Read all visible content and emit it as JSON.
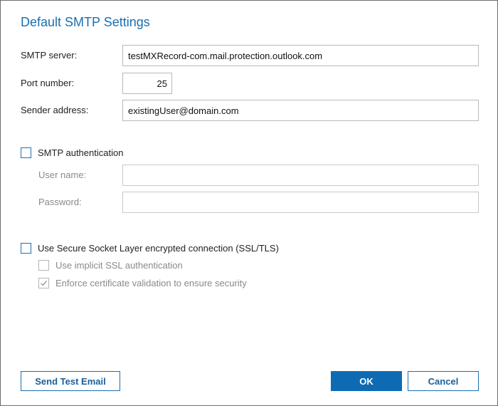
{
  "dialog": {
    "title": "Default SMTP Settings"
  },
  "smtp": {
    "server_label": "SMTP server:",
    "server_value": "testMXRecord-com.mail.protection.outlook.com",
    "port_label": "Port number:",
    "port_value": "25",
    "sender_label": "Sender address:",
    "sender_value": "existingUser@domain.com"
  },
  "auth": {
    "checkbox_label": "SMTP authentication",
    "checked": false,
    "username_label": "User name:",
    "username_value": "",
    "password_label": "Password:",
    "password_value": ""
  },
  "ssl": {
    "checkbox_label": "Use Secure Socket Layer encrypted connection (SSL/TLS)",
    "checked": false,
    "implicit_label": "Use implicit SSL authentication",
    "implicit_checked": false,
    "enforce_label": "Enforce certificate validation to ensure security",
    "enforce_checked": true
  },
  "buttons": {
    "send_test": "Send Test Email",
    "ok": "OK",
    "cancel": "Cancel"
  },
  "colors": {
    "accent": "#0e6bb3",
    "title": "#1a6fb0",
    "disabled_text": "#8a8a8a"
  }
}
